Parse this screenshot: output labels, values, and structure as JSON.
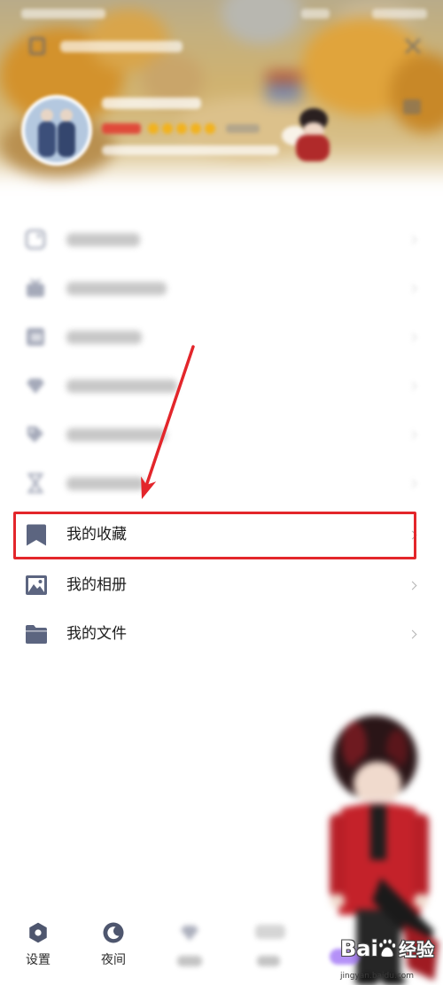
{
  "header": {
    "avatar_icon": "avatar-icon",
    "menu_icon": "qr-code-icon",
    "close_icon": "close-icon",
    "edit_icon": "edit-icon"
  },
  "menu": {
    "blurred_items": [
      {
        "icon": "live-icon"
      },
      {
        "icon": "vip-icon"
      },
      {
        "icon": "wallet-icon"
      },
      {
        "icon": "dress-up-icon"
      },
      {
        "icon": "tag-icon"
      },
      {
        "icon": "traffic-icon"
      }
    ],
    "items": [
      {
        "label": "我的收藏",
        "icon": "bookmark-icon",
        "highlighted": true
      },
      {
        "label": "我的相册",
        "icon": "picture-icon",
        "highlighted": false
      },
      {
        "label": "我的文件",
        "icon": "folder-icon",
        "highlighted": false
      }
    ],
    "chevron_icon": "chevron-right-icon"
  },
  "bottom_bar": {
    "items": [
      {
        "label": "设置",
        "icon": "gear-icon"
      },
      {
        "label": "夜间",
        "icon": "moon-icon"
      }
    ],
    "blurred_items": [
      {
        "icon": "dress-up-icon"
      },
      {
        "icon": "weather-icon"
      }
    ]
  },
  "annotation": {
    "box_color": "#e3262b",
    "arrow_color": "#e3262b"
  },
  "watermark": {
    "brand_latin": "Bai",
    "brand_cn": "经验",
    "url": "jingyan.baidu.com"
  },
  "colors": {
    "icon": "#5c6580",
    "text": "#1c1c1c",
    "chevron": "#b3b3b3",
    "background": "#ffffff"
  }
}
